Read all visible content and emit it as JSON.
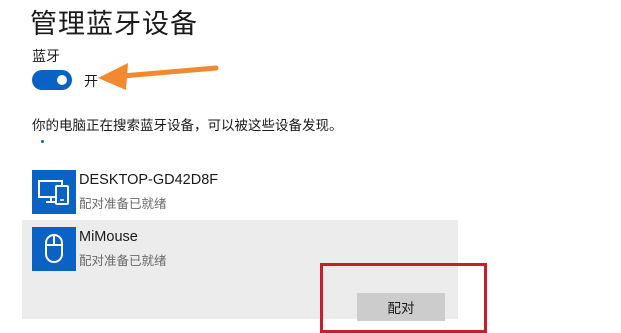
{
  "page": {
    "title": "管理蓝牙设备"
  },
  "bluetooth": {
    "label": "蓝牙",
    "toggle_state": "开",
    "toggle_on": true,
    "accent_color": "#0a62c5"
  },
  "status": {
    "searching_text": "你的电脑正在搜索蓝牙设备，可以被这些设备发现。"
  },
  "devices": [
    {
      "name": "DESKTOP-GD42D8F",
      "status": "配对准备已就绪",
      "icon": "computer-phone-icon"
    },
    {
      "name": "MiMouse",
      "status": "配对准备已就绪",
      "icon": "mouse-icon",
      "selected": true,
      "pair_label": "配对"
    }
  ],
  "annotations": {
    "arrow_color": "#f18a2e",
    "highlight_color": "#c81f26"
  }
}
